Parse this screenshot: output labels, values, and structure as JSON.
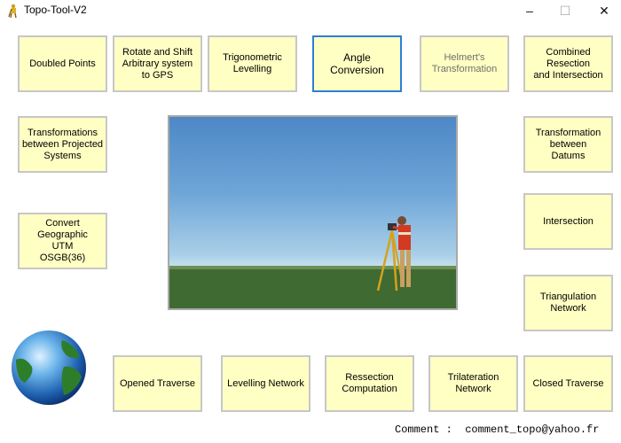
{
  "window": {
    "title": "Topo-Tool-V2",
    "minimize": "–",
    "maximize": "☐",
    "close": "✕"
  },
  "buttons": {
    "doubled_points": "Doubled Points",
    "rotate_shift": "Rotate and Shift\nArbitrary system\nto GPS",
    "trig_levelling": "Trigonometric\nLevelling",
    "angle_conversion": "Angle\nConversion",
    "helmert": "Helmert's\nTransformation",
    "combined_resection": "Combined\nResection\nand Intersection",
    "transformations_projected": "Transformations\nbetween Projected\nSystems",
    "transformation_datums": "Transformation\nbetween\nDatums",
    "convert_geographic": "Convert\nGeographic\nUTM\nOSGB(36)",
    "intersection": "Intersection",
    "triangulation_network": "Triangulation\nNetwork",
    "opened_traverse": "Opened Traverse",
    "levelling_network": "Levelling Network",
    "ressection": "Ressection\nComputation",
    "trilateration": "Trilateration\nNetwork",
    "closed_traverse": "Closed Traverse"
  },
  "footer": {
    "comment": "Comment :  comment_topo@yahoo.fr"
  },
  "colors": {
    "button_bg": "#ffffc3",
    "selected_border": "#2c7fd4"
  }
}
